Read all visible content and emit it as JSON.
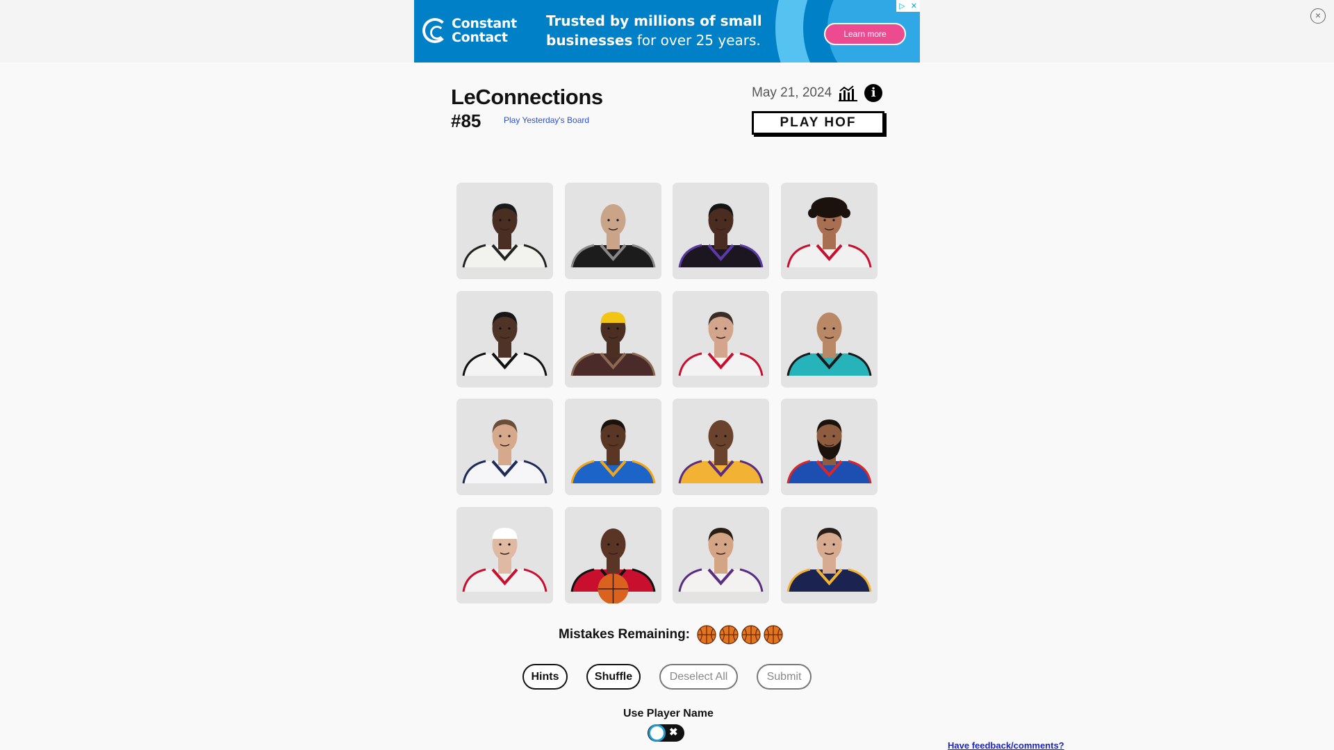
{
  "ad": {
    "brand_line1": "Constant",
    "brand_line2": "Contact",
    "headline_bold": "Trusted by millions of small",
    "headline_bold2": "businesses",
    "headline_rest": " for over 25 years.",
    "cta": "Learn more",
    "close_glyph": "×",
    "colors": {
      "background": "#0080c6",
      "cta": "#ec4c8f"
    }
  },
  "header": {
    "title": "LeConnections",
    "number": "#85",
    "yesterday_link": "Play Yesterday's Board",
    "date": "May 21, 2024",
    "stats_icon": "bar-chart-icon",
    "info_icon": "info-icon",
    "info_glyph": "i",
    "hof_button": "PLAY HOF"
  },
  "grid": {
    "tiles": [
      {
        "name": "player-1",
        "skin": "#4a2e22",
        "hair": "#1a1a1a",
        "jersey": "#f2f2ef",
        "trim": "#222222",
        "style": "short"
      },
      {
        "name": "player-2",
        "skin": "#caa488",
        "hair": "#b58e72",
        "jersey": "#1c1c1c",
        "trim": "#888888",
        "style": "bald"
      },
      {
        "name": "player-3",
        "skin": "#4a2d20",
        "hair": "#141414",
        "jersey": "#1b1620",
        "trim": "#5b3aa7",
        "style": "short"
      },
      {
        "name": "player-4",
        "skin": "#a86f52",
        "hair": "#1b120d",
        "jersey": "#f1f1f1",
        "trim": "#c8102e",
        "style": "curly"
      },
      {
        "name": "player-5",
        "skin": "#4e3326",
        "hair": "#171717",
        "jersey": "#f4f4f4",
        "trim": "#111111",
        "style": "short"
      },
      {
        "name": "player-6",
        "skin": "#4a2f22",
        "hair": "#f2c413",
        "jersey": "#4b2a2a",
        "trim": "#8b6a50",
        "style": "headband"
      },
      {
        "name": "player-7",
        "skin": "#d3a58c",
        "hair": "#3a2d25",
        "jersey": "#f3f3f3",
        "trim": "#c8102e",
        "style": "short"
      },
      {
        "name": "player-8",
        "skin": "#b98866",
        "hair": "#2a1e18",
        "jersey": "#26b3b9",
        "trim": "#1a1a1a",
        "style": "bald"
      },
      {
        "name": "player-9",
        "skin": "#d6a98d",
        "hair": "#6a4e36",
        "jersey": "#f6f6f8",
        "trim": "#1d2a5a",
        "style": "short"
      },
      {
        "name": "player-10",
        "skin": "#5a3625",
        "hair": "#1a120d",
        "jersey": "#1d64c8",
        "trim": "#f2a51a",
        "style": "short"
      },
      {
        "name": "player-11",
        "skin": "#6a432e",
        "hair": "#1a1a1a",
        "jersey": "#f2b233",
        "trim": "#5a2d81",
        "style": "bald"
      },
      {
        "name": "player-12",
        "skin": "#8e5d3f",
        "hair": "#1b120d",
        "jersey": "#1d4fb3",
        "trim": "#d9262b",
        "style": "beard"
      },
      {
        "name": "player-13",
        "skin": "#e0b9a2",
        "hair": "#ffffff",
        "jersey": "#f3f3f3",
        "trim": "#c8102e",
        "style": "headband"
      },
      {
        "name": "player-14",
        "skin": "#5a3425",
        "hair": "#1a1a1a",
        "jersey": "#c8102e",
        "trim": "#111111",
        "style": "ball"
      },
      {
        "name": "player-15",
        "skin": "#d4a585",
        "hair": "#2a1d16",
        "jersey": "#f4f1f1",
        "trim": "#5a2d81",
        "style": "short"
      },
      {
        "name": "player-16",
        "skin": "#d6ab8f",
        "hair": "#2a1f18",
        "jersey": "#1b2450",
        "trim": "#f2b233",
        "style": "short"
      }
    ]
  },
  "mistakes": {
    "label": "Mistakes Remaining:",
    "remaining": 4,
    "icon": "basketball-icon"
  },
  "buttons": {
    "hints": "Hints",
    "shuffle": "Shuffle",
    "deselect": "Deselect All",
    "submit": "Submit"
  },
  "toggle": {
    "label": "Use Player Name",
    "off_glyph": "✖"
  },
  "feedback_link": "Have feedback/comments?"
}
